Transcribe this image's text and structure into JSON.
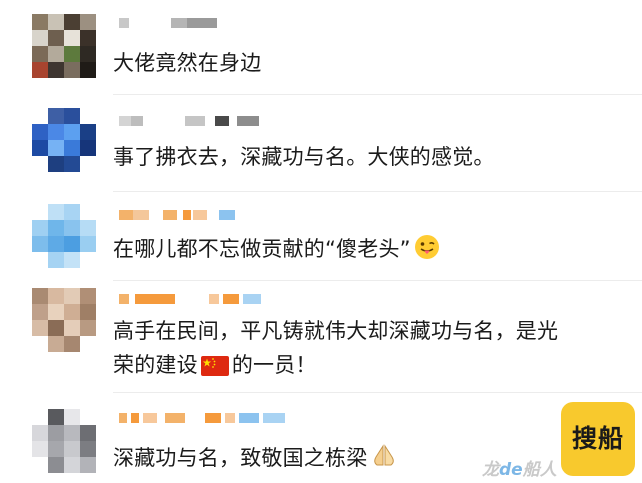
{
  "comments": [
    {
      "text": "大佬竟然在身边"
    },
    {
      "text": "事了拂衣去，深藏功与名。大侠的感觉。"
    },
    {
      "text": "在哪儿都不忘做贡献的“傻老头”",
      "emoji": "tongue-out-face"
    },
    {
      "line1": "高手在民间，平凡铸就伟大却深藏功与名，是光",
      "line2_a": "荣的建设",
      "line2_b": "的一员！",
      "emoji": "china-flag"
    },
    {
      "text": "深藏功与名，致敬国之栋梁",
      "emoji": "praying-hands"
    }
  ],
  "overlay": {
    "button_label": "搜船",
    "watermark_a": "龙",
    "watermark_b": "de",
    "watermark_c": "船人"
  }
}
